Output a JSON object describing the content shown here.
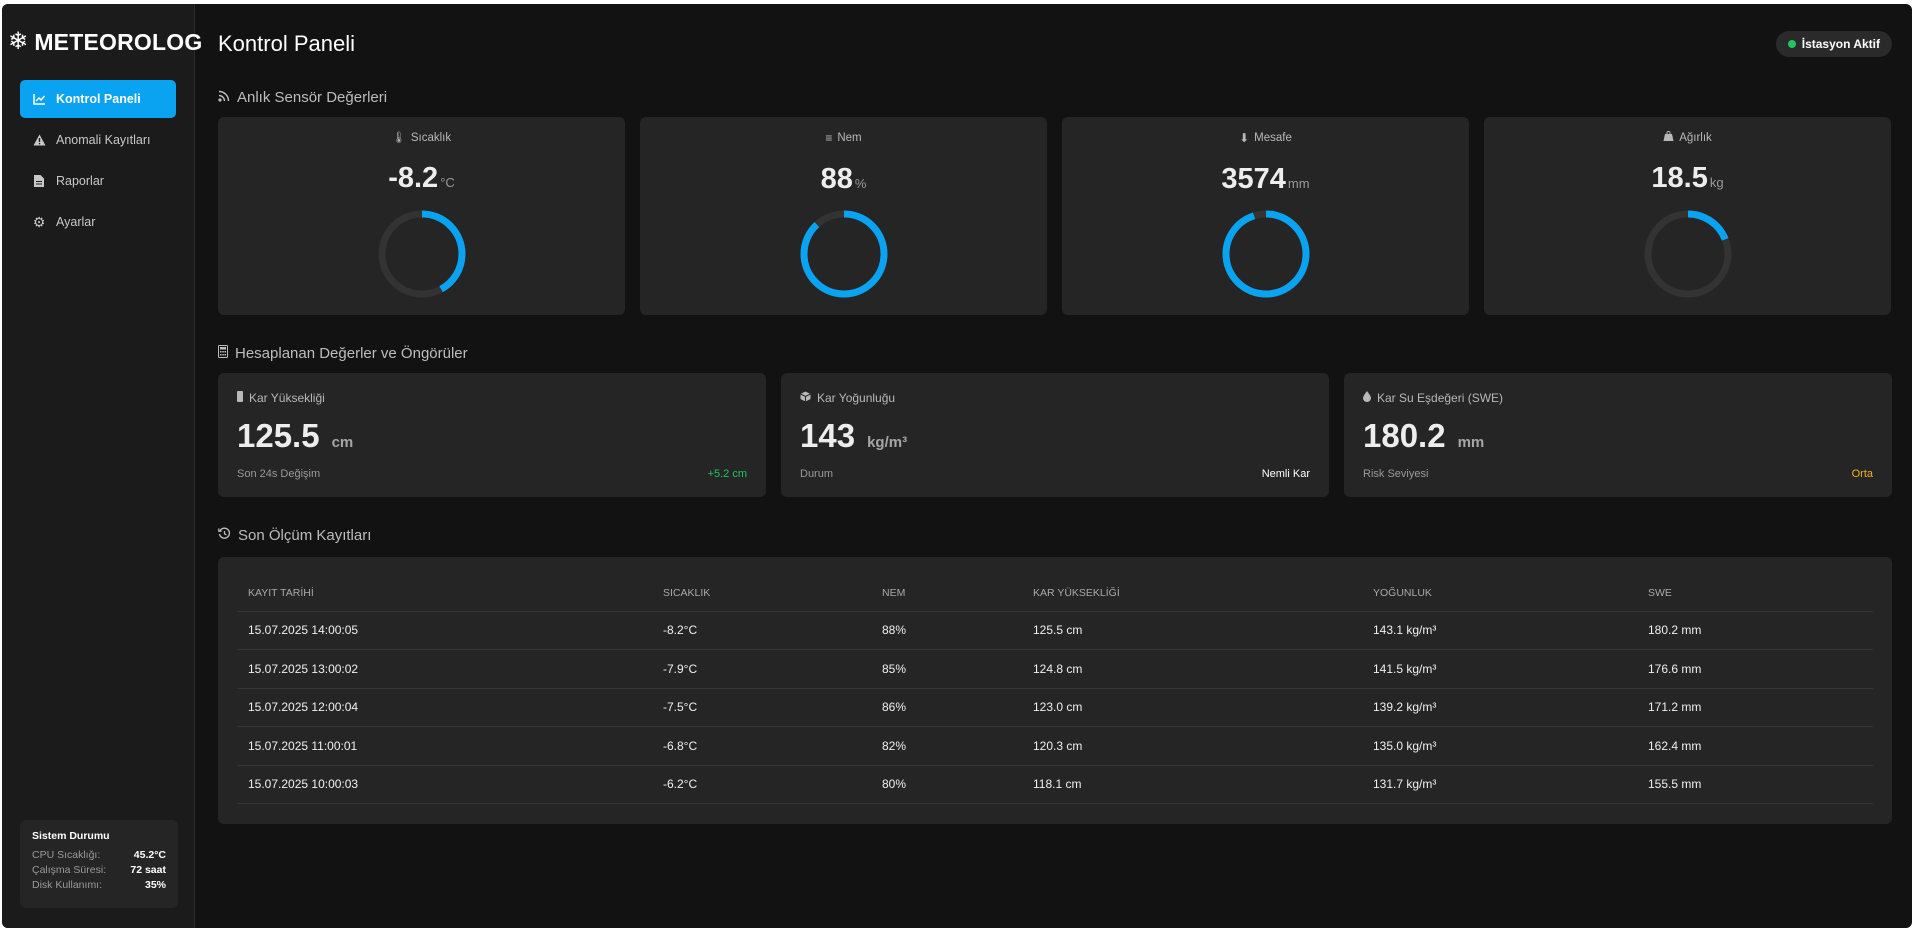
{
  "brand": {
    "name": "METEOROLOG",
    "icon": "snowflake-icon"
  },
  "sidebar": {
    "items": [
      {
        "label": "Kontrol Paneli",
        "icon": "chart-line-icon",
        "active": true
      },
      {
        "label": "Anomali Kayıtları",
        "icon": "warning-icon",
        "active": false
      },
      {
        "label": "Raporlar",
        "icon": "document-icon",
        "active": false
      },
      {
        "label": "Ayarlar",
        "icon": "gear-icon",
        "active": false
      }
    ]
  },
  "system": {
    "title": "Sistem Durumu",
    "rows": [
      {
        "label": "CPU Sıcaklığı:",
        "value": "45.2°C"
      },
      {
        "label": "Çalışma Süresi:",
        "value": "72 saat"
      },
      {
        "label": "Disk Kullanımı:",
        "value": "35%"
      }
    ]
  },
  "header": {
    "title": "Kontrol Paneli",
    "status": "İstasyon Aktif",
    "status_color": "#22c55e"
  },
  "sensors": {
    "title": "Anlık Sensör Değerleri",
    "cards": [
      {
        "label": "Sıcaklık",
        "icon": "thermometer-icon",
        "value": "-8.2",
        "unit": "°C",
        "fill": 0.42
      },
      {
        "label": "Nem",
        "icon": "bars-icon",
        "value": "88",
        "unit": "%",
        "fill": 0.88
      },
      {
        "label": "Mesafe",
        "icon": "arrow-down-icon",
        "value": "3574",
        "unit": "mm",
        "fill": 0.95
      },
      {
        "label": "Ağırlık",
        "icon": "weight-icon",
        "value": "18.5",
        "unit": "kg",
        "fill": 0.19
      }
    ]
  },
  "computed": {
    "title": "Hesaplanan Değerler ve Öngörüler",
    "cards": [
      {
        "label": "Kar Yüksekliği",
        "icon": "ruler-icon",
        "value": "125.5",
        "unit": "cm",
        "foot_label": "Son 24s Değişim",
        "foot_value": "+5.2 cm",
        "foot_color": "green"
      },
      {
        "label": "Kar Yoğunluğu",
        "icon": "cube-icon",
        "value": "143",
        "unit": "kg/m³",
        "foot_label": "Durum",
        "foot_value": "Nemli Kar",
        "foot_color": "white"
      },
      {
        "label": "Kar Su Eşdeğeri (SWE)",
        "icon": "drop-icon",
        "value": "180.2",
        "unit": "mm",
        "foot_label": "Risk Seviyesi",
        "foot_value": "Orta",
        "foot_color": "amber"
      }
    ]
  },
  "records": {
    "title": "Son Ölçüm Kayıtları",
    "columns": [
      "KAYIT TARİHİ",
      "SICAKLIK",
      "NEM",
      "KAR YÜKSEKLİĞİ",
      "YOĞUNLUK",
      "SWE"
    ],
    "rows": [
      [
        "15.07.2025 14:00:05",
        "-8.2°C",
        "88%",
        "125.5 cm",
        "143.1 kg/m³",
        "180.2 mm"
      ],
      [
        "15.07.2025 13:00:02",
        "-7.9°C",
        "85%",
        "124.8 cm",
        "141.5 kg/m³",
        "176.6 mm"
      ],
      [
        "15.07.2025 12:00:04",
        "-7.5°C",
        "86%",
        "123.0 cm",
        "139.2 kg/m³",
        "171.2 mm"
      ],
      [
        "15.07.2025 11:00:01",
        "-6.8°C",
        "82%",
        "120.3 cm",
        "135.0 kg/m³",
        "162.4 mm"
      ],
      [
        "15.07.2025 10:00:03",
        "-6.2°C",
        "80%",
        "118.1 cm",
        "131.7 kg/m³",
        "155.5 mm"
      ]
    ]
  },
  "colors": {
    "accent": "#0aa3f2",
    "track": "#333333",
    "card": "#252525"
  }
}
